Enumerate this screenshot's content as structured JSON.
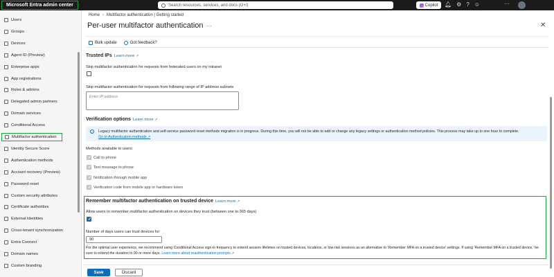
{
  "topbar": {
    "brand": "Microsoft Entra admin center",
    "search_placeholder": "Search resources, services, and docs (G+/)",
    "copilot_label": "Copilot"
  },
  "sidebar": {
    "items": [
      {
        "label": "Users",
        "icon": "user-icon"
      },
      {
        "label": "Groups",
        "icon": "group-icon"
      },
      {
        "label": "Devices",
        "icon": "device-icon"
      },
      {
        "label": "Agent ID (Preview)",
        "icon": "agent-icon"
      },
      {
        "label": "Enterprise apps",
        "icon": "apps-icon"
      },
      {
        "label": "App registrations",
        "icon": "app-registration-icon"
      },
      {
        "label": "Roles & admins",
        "icon": "roles-icon"
      },
      {
        "label": "Delegated admin partners",
        "icon": "partners-icon"
      },
      {
        "label": "Domain services",
        "icon": "domain-services-icon"
      },
      {
        "label": "Conditional Access",
        "icon": "lock-icon"
      },
      {
        "label": "Multifactor authentication",
        "icon": "mfa-icon",
        "selected": true
      },
      {
        "label": "Identity Secure Score",
        "icon": "score-icon"
      },
      {
        "label": "Authentication methods",
        "icon": "key-icon"
      },
      {
        "label": "Account recovery (Preview)",
        "icon": "recovery-icon"
      },
      {
        "label": "Password reset",
        "icon": "password-icon"
      },
      {
        "label": "Custom security attributes",
        "icon": "attributes-icon"
      },
      {
        "label": "Certificate authorities",
        "icon": "certificate-icon"
      },
      {
        "label": "External Identities",
        "icon": "external-icon"
      },
      {
        "label": "Cross-tenant synchronization",
        "icon": "sync-icon"
      },
      {
        "label": "Entra Connect",
        "icon": "connect-icon"
      },
      {
        "label": "Domain names",
        "icon": "domain-icon"
      },
      {
        "label": "Custom branding",
        "icon": "branding-icon"
      }
    ]
  },
  "breadcrumb": {
    "home": "Home",
    "current": "Multifactor authentication | Getting started"
  },
  "page": {
    "title": "Per-user multifactor authentication"
  },
  "toolbar": {
    "bulk_update": "Bulk update",
    "feedback": "Got feedback?"
  },
  "trusted_ips": {
    "title": "Trusted IPs",
    "learn_more": "Learn more",
    "skip_federated": "Skip multifactor authentication for requests from federated users on my intranet",
    "skip_range": "Skip multifactor authentication for requests from following range of IP address subnets",
    "ip_placeholder": "Enter IP address"
  },
  "verification": {
    "title": "Verification options",
    "learn_more": "Learn more",
    "info": "Legacy multifactor authentication and self-service password reset methods migration is in progress. During this time, you will not be able to add or change any legacy settings or authentication method policies. This process may take up to one hour to complete.",
    "info_link": "Go to Authentication methods",
    "methods_label": "Methods available to users:",
    "methods": [
      "Call to phone",
      "Text message to phone",
      "Notification through mobile app",
      "Verification code from mobile app or hardware token"
    ]
  },
  "remember": {
    "title": "Remember multifactor authentication on trusted device",
    "learn_more": "Learn more",
    "allow_label": "Allow users to remember multifactor authentication on devices they trust (between one to 365 days)",
    "days_label": "Number of days users can trust devices for",
    "days_value": "90",
    "note": "For the optimal user experience, we recommend using Conditional Access sign-in frequency to extend session lifetimes on trusted devices, locations, or low-risk sessions as an alternative to 'Remember MFA on a trusted device' settings. If using 'Remember MFA on a trusted device,' be sure to extend the duration to 90 or more days.",
    "note_link": "Learn more about reauthentication prompts"
  },
  "actions": {
    "save": "Save",
    "discard": "Discard"
  },
  "colors": {
    "accent": "#0f6cbd",
    "highlight": "#14a83b",
    "topbar": "#1b1b1b"
  }
}
